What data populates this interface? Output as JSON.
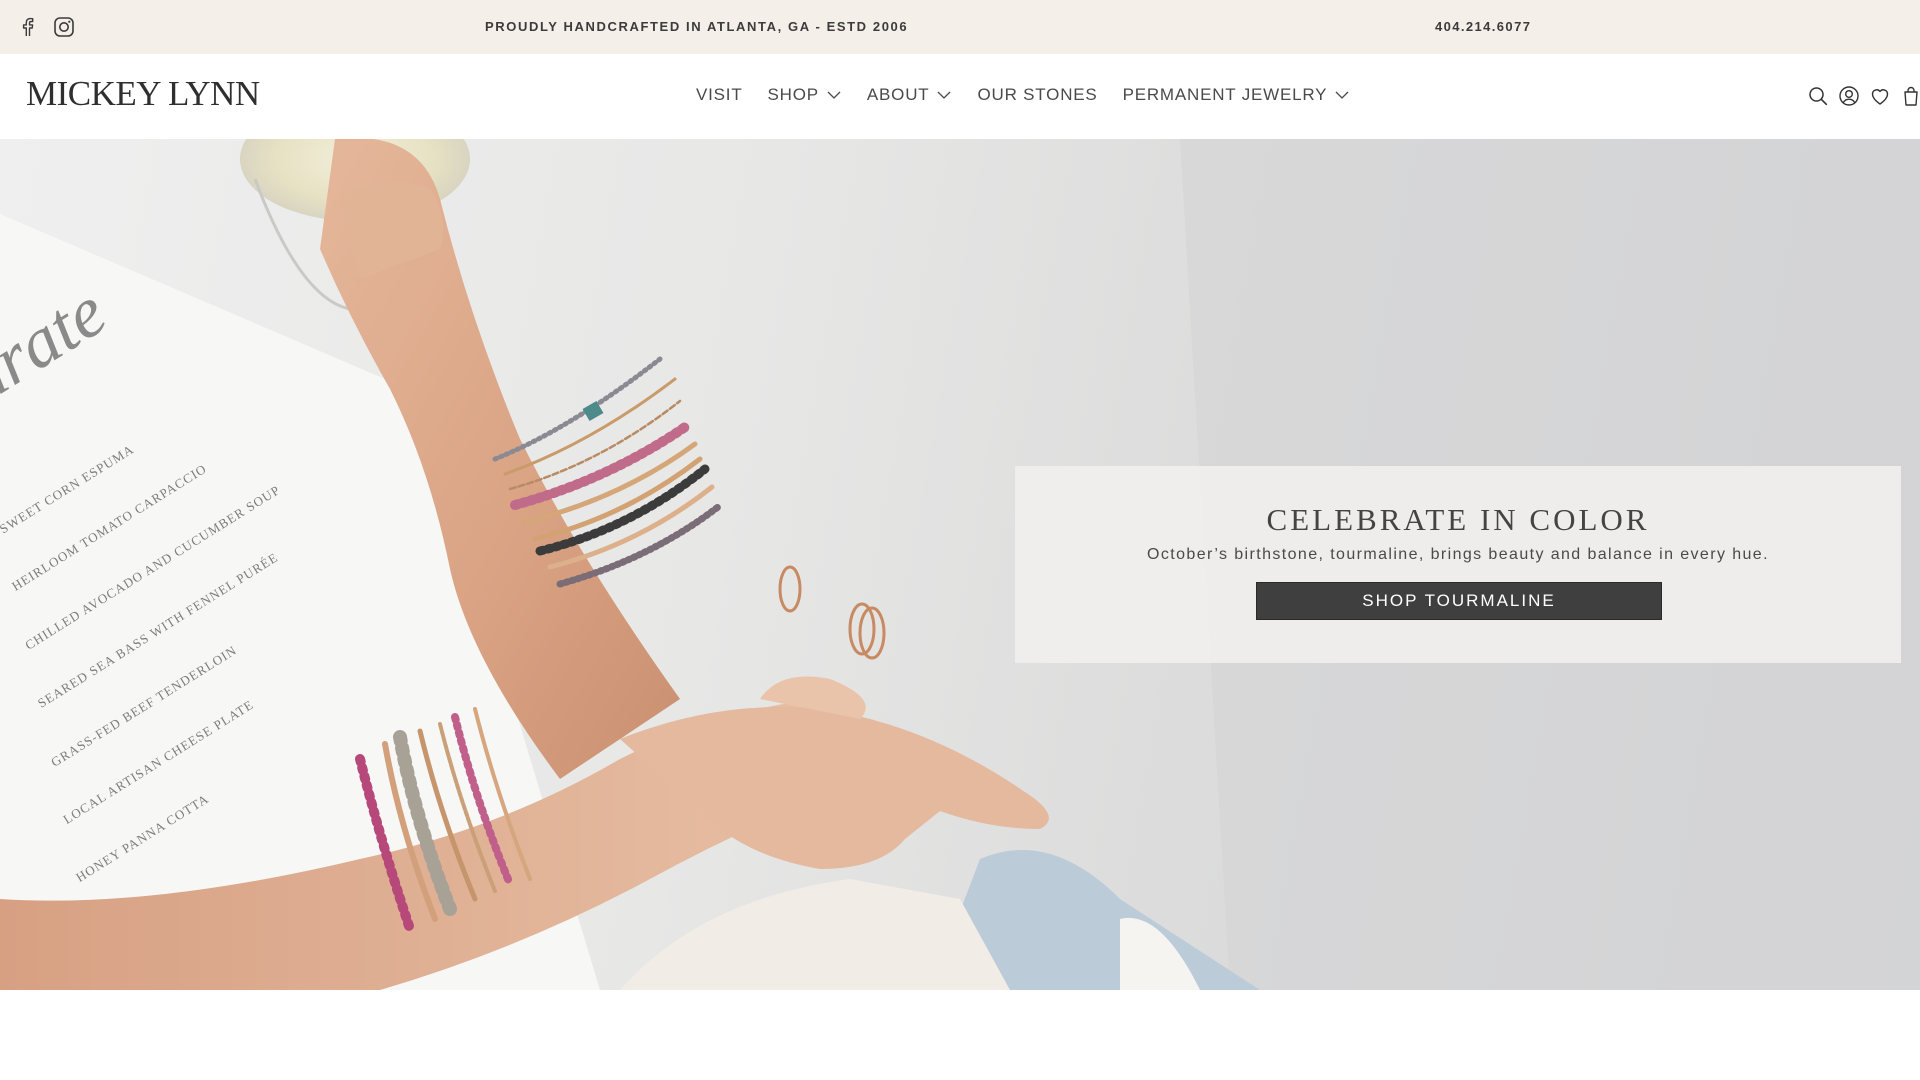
{
  "announcement": {
    "text": "PROUDLY HANDCRAFTED IN ATLANTA, GA - ESTD 2006",
    "phone": "404.214.6077",
    "social_icons": [
      "facebook-icon",
      "instagram-icon"
    ]
  },
  "header": {
    "logo": "MICKEY LYNN",
    "nav": [
      {
        "label": "VISIT",
        "has_dropdown": false
      },
      {
        "label": "SHOP",
        "has_dropdown": true
      },
      {
        "label": "ABOUT",
        "has_dropdown": true
      },
      {
        "label": "OUR STONES",
        "has_dropdown": false
      },
      {
        "label": "PERMANENT JEWELRY",
        "has_dropdown": true
      }
    ],
    "icons": [
      "search-icon",
      "account-icon",
      "wishlist-icon",
      "cart-icon"
    ]
  },
  "hero": {
    "title": "CELEBRATE IN COLOR",
    "subtitle": "October’s birthstone, tourmaline, brings beauty and balance in every hue.",
    "button_label": "SHOP TOURMALINE",
    "menu_card": {
      "heading": "urate",
      "items": [
        "SWEET CORN ESPUMA",
        "HEIRLOOM TOMATO CARPACCIO",
        "CHILLED AVOCADO AND CUCUMBER SOUP",
        "SEARED SEA BASS WITH FENNEL PURÉE",
        "GRASS-FED BEEF TENDERLOIN",
        "LOCAL ARTISAN CHEESE PLATE",
        "HONEY PANNA COTTA"
      ]
    }
  },
  "colors": {
    "announcement_bg": "#f5efea",
    "button_bg": "#3f3f3f",
    "text": "#3c3c3c"
  }
}
